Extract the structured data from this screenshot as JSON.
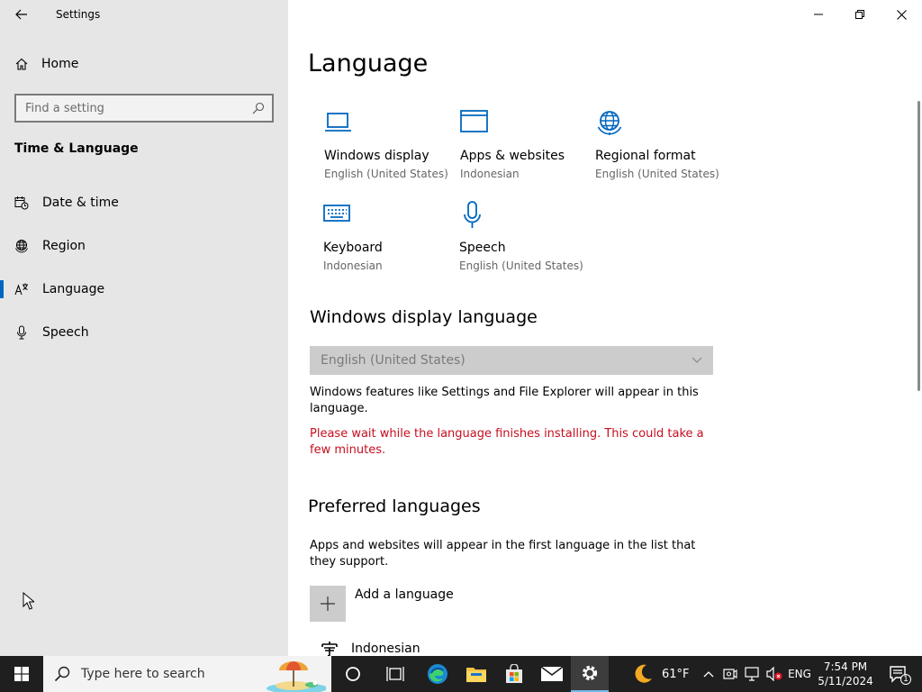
{
  "window": {
    "title": "Settings"
  },
  "sidebar": {
    "home_label": "Home",
    "search_placeholder": "Find a setting",
    "section_title": "Time & Language",
    "items": [
      {
        "label": "Date & time",
        "icon": "calendar-clock-icon"
      },
      {
        "label": "Region",
        "icon": "globe-icon"
      },
      {
        "label": "Language",
        "icon": "language-icon",
        "active": true
      },
      {
        "label": "Speech",
        "icon": "microphone-icon"
      }
    ]
  },
  "main": {
    "title": "Language",
    "tiles": [
      {
        "label": "Windows display",
        "sub": "English (United States)",
        "icon": "laptop-icon"
      },
      {
        "label": "Apps & websites",
        "sub": "Indonesian",
        "icon": "browser-window-icon"
      },
      {
        "label": "Regional format",
        "sub": "English (United States)",
        "icon": "globe-settings-icon"
      },
      {
        "label": "Keyboard",
        "sub": "Indonesian",
        "icon": "keyboard-icon"
      },
      {
        "label": "Speech",
        "sub": "English (United States)",
        "icon": "microphone-icon"
      }
    ],
    "display_language": {
      "heading": "Windows display language",
      "selected": "English (United States)",
      "description": "Windows features like Settings and File Explorer will appear in this language.",
      "warning": "Please wait while the language finishes installing. This could take a few minutes."
    },
    "preferred": {
      "heading": "Preferred languages",
      "description": "Apps and websites will appear in the first language in the list that they support.",
      "add_label": "Add a language",
      "languages": [
        "Indonesian"
      ]
    }
  },
  "taskbar": {
    "search_placeholder": "Type here to search",
    "weather_temp": "61°F",
    "input_lang": "ENG",
    "time": "7:54 PM",
    "date": "5/11/2024",
    "notification_count": "1"
  },
  "colors": {
    "accent": "#0067c0",
    "warning": "#c50f1f",
    "sidebar_bg": "#e6e6e6",
    "taskbar_bg": "#1f1f1f"
  }
}
